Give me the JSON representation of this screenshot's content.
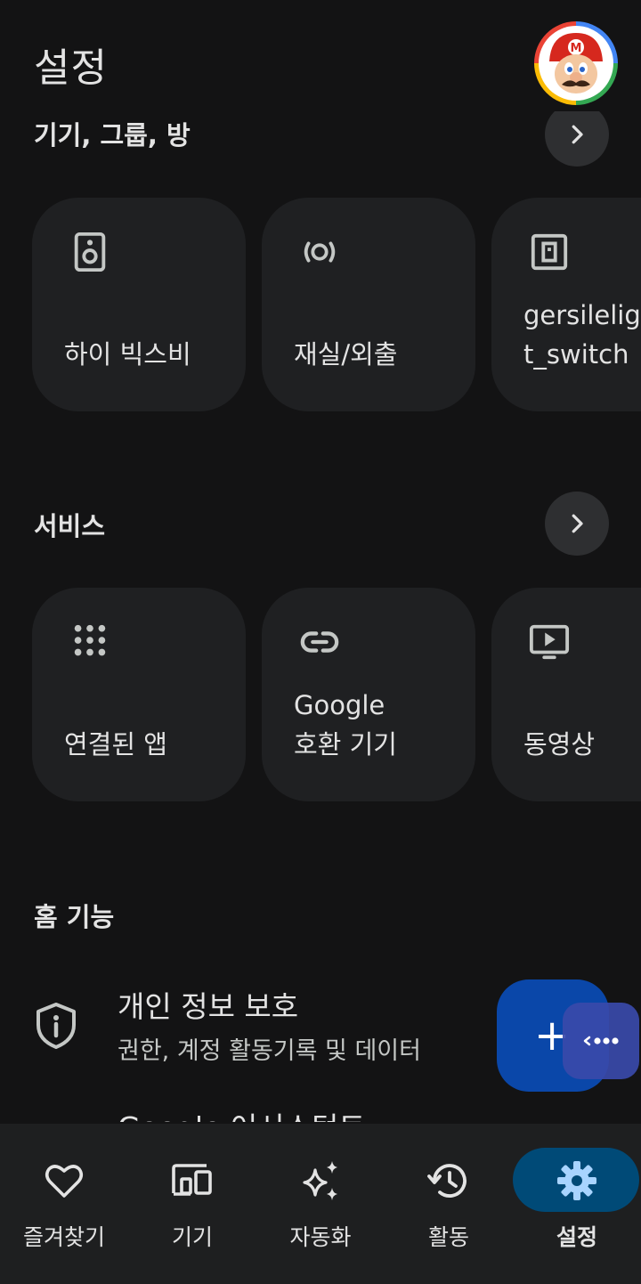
{
  "header": {
    "title": "설정"
  },
  "sections": {
    "devices": {
      "title": "기기, 그룹, 방",
      "cards": [
        {
          "label": "하이 빅스비",
          "icon": "speaker-icon"
        },
        {
          "label": "재실/외출",
          "icon": "presence-sensor-icon"
        },
        {
          "label": "gersilelig\nt_switch",
          "icon": "switch-icon"
        }
      ]
    },
    "services": {
      "title": "서비스",
      "cards": [
        {
          "label": "연결된 앱",
          "icon": "apps-grid-icon"
        },
        {
          "label": "Google\n호환 기기",
          "icon": "link-icon"
        },
        {
          "label": "동영상",
          "icon": "video-icon"
        }
      ]
    },
    "home_features": {
      "title": "홈 기능",
      "items": [
        {
          "title": "개인 정보 보호",
          "subtitle": "권한, 계정 활동기록 및 데이터",
          "icon": "shield-info-icon"
        },
        {
          "title": "Google 어시스턴트",
          "icon": "assistant-icon"
        }
      ]
    }
  },
  "fab": {
    "plus": "+",
    "icon": "add-icon"
  },
  "bottom_nav": [
    {
      "label": "즐겨찾기",
      "icon": "heart-icon",
      "active": false
    },
    {
      "label": "기기",
      "icon": "devices-icon",
      "active": false
    },
    {
      "label": "자동화",
      "icon": "sparkle-icon",
      "active": false
    },
    {
      "label": "활동",
      "icon": "history-icon",
      "active": false
    },
    {
      "label": "설정",
      "icon": "gear-icon",
      "active": true
    }
  ],
  "colors": {
    "background": "#131314",
    "card": "#1f2022",
    "fab": "#0a47a9",
    "nav_active_pill": "#004a77",
    "avatar_ring": [
      "#4285f4",
      "#34a853",
      "#fbbc05",
      "#ea4335"
    ]
  }
}
